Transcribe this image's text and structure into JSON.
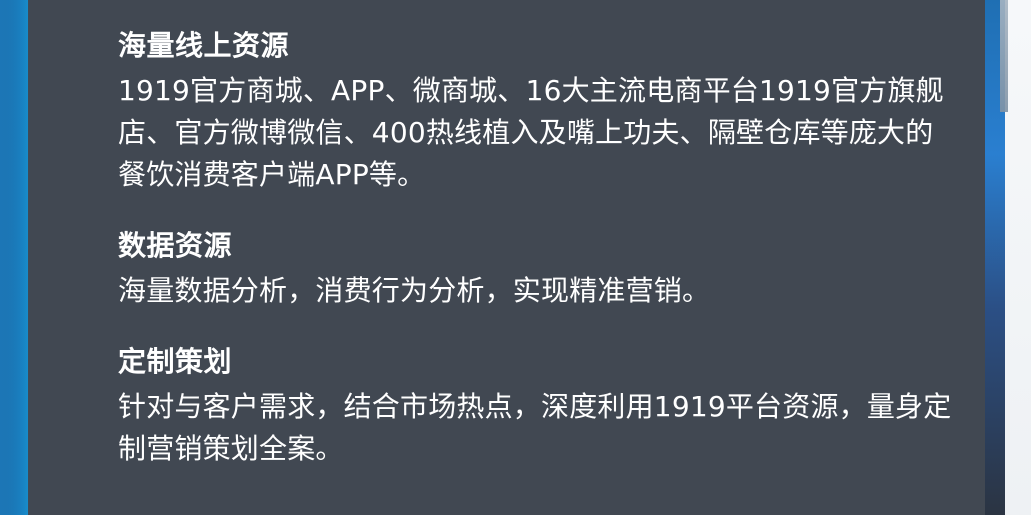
{
  "sections": [
    {
      "title": "海量线上资源",
      "body": "1919官方商城、APP、微商城、16大主流电商平台1919官方旗舰店、官方微博微信、400热线植入及嘴上功夫、隔壁仓库等庞大的餐饮消费客户端APP等。"
    },
    {
      "title": "数据资源",
      "body": "海量数据分析，消费行为分析，实现精准营销。"
    },
    {
      "title": "定制策划",
      "body": "针对与客户需求，结合市场热点，深度利用1919平台资源，量身定制营销策划全案。"
    }
  ],
  "colors": {
    "panel": "#414852",
    "text": "#ffffff",
    "accent_left": "#1aa2d8",
    "accent_right": "#2a7fd0"
  }
}
